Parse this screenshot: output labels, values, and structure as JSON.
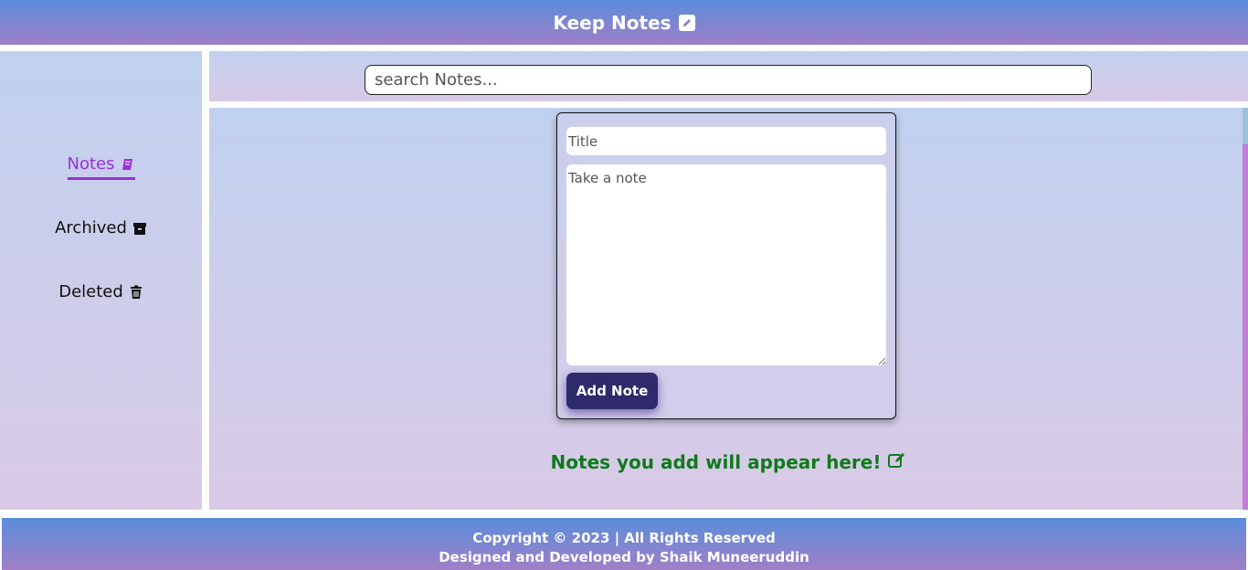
{
  "header": {
    "title": "Keep Notes",
    "icon": "edit-square-icon"
  },
  "search": {
    "placeholder": "search Notes..."
  },
  "sidebar": {
    "items": [
      {
        "label": "Notes",
        "icon": "book-icon",
        "active": true
      },
      {
        "label": "Archived",
        "icon": "archive-box-icon",
        "active": false
      },
      {
        "label": "Deleted",
        "icon": "trash-icon",
        "active": false
      }
    ]
  },
  "note_form": {
    "title_placeholder": "Title",
    "body_placeholder": "Take a note",
    "add_label": "Add Note"
  },
  "empty_message": "Notes you add will appear here!",
  "footer": {
    "line1": "Copyright © 2023 | All Rights Reserved",
    "line2": "Designed and Developed by Shaik Muneeruddin"
  },
  "colors": {
    "accent": "#9b30d6",
    "button": "#2e2a6b",
    "empty_text": "#0f7a1c"
  }
}
